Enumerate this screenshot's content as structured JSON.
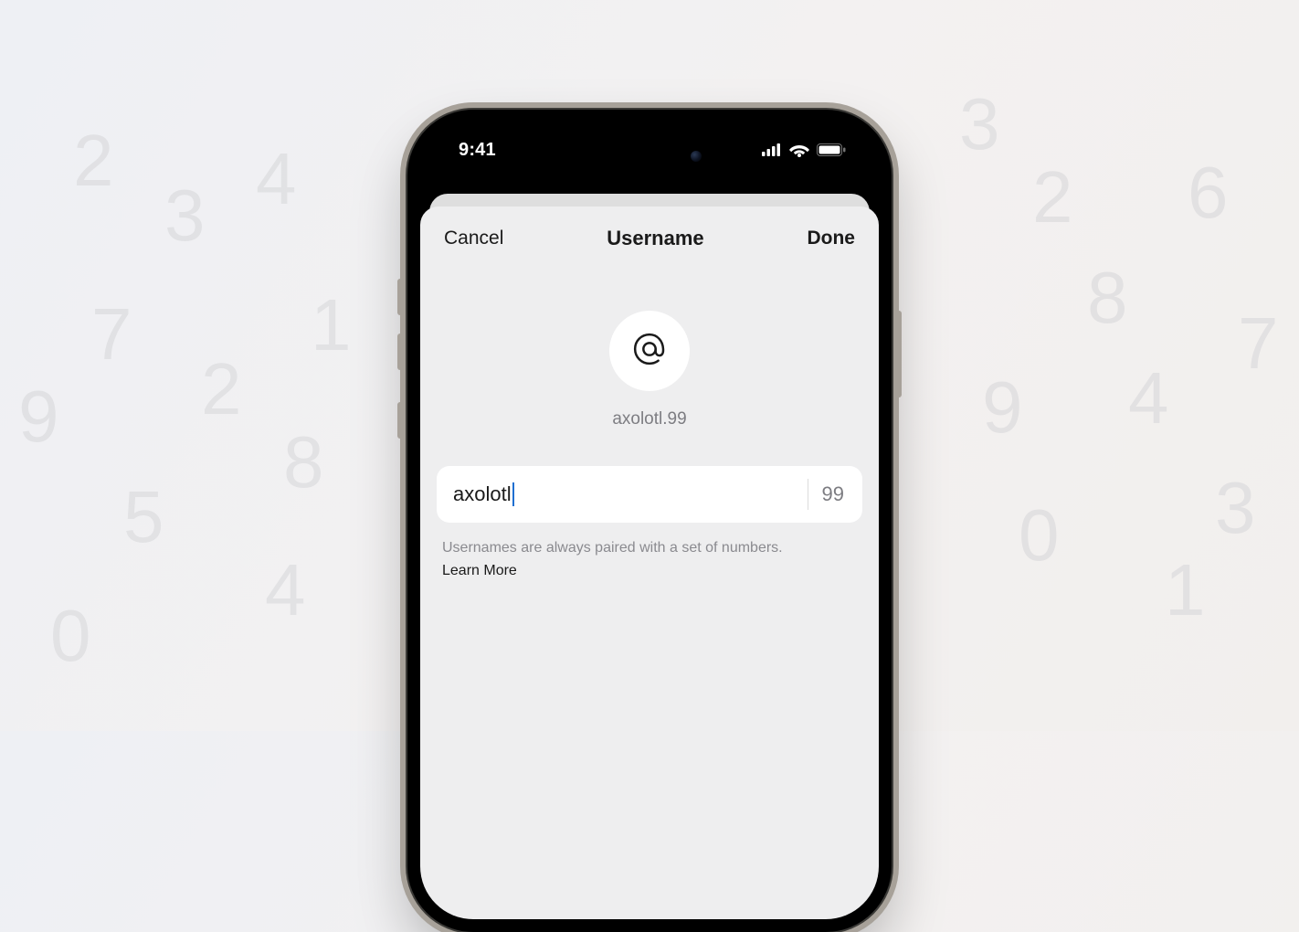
{
  "statusBar": {
    "time": "9:41"
  },
  "modal": {
    "cancel": "Cancel",
    "title": "Username",
    "done": "Done"
  },
  "username": {
    "preview": "axolotl.99",
    "value": "axolotl",
    "suffix": "99",
    "helpText": "Usernames are always paired with a set of numbers.",
    "learnMore": "Learn More"
  },
  "background": {
    "leftNumbers": [
      "2",
      "4",
      "3",
      "7",
      "1",
      "9",
      "2",
      "8",
      "5",
      "4",
      "0"
    ],
    "rightNumbers": [
      "3",
      "2",
      "6",
      "8",
      "7",
      "9",
      "4",
      "3",
      "0",
      "1"
    ]
  }
}
